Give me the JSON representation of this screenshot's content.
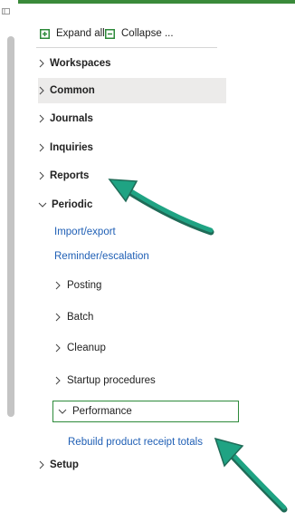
{
  "toolbar": {
    "expand_label": "Expand all",
    "collapse_label": "Collapse ..."
  },
  "tree": {
    "workspaces": "Workspaces",
    "common": "Common",
    "journals": "Journals",
    "inquiries": "Inquiries",
    "reports": "Reports",
    "periodic": "Periodic",
    "setup": "Setup"
  },
  "periodic_items": {
    "import_export": "Import/export",
    "reminder_escalation": "Reminder/escalation",
    "posting": "Posting",
    "batch": "Batch",
    "cleanup": "Cleanup",
    "startup_procedures": "Startup procedures",
    "performance": "Performance",
    "rebuild_totals": "Rebuild product receipt totals"
  },
  "colors": {
    "accent_green": "#3a8a3a",
    "link_blue": "#1f5fb5",
    "highlight_row": "#ecebea",
    "arrow_teal": "#1fa383"
  }
}
